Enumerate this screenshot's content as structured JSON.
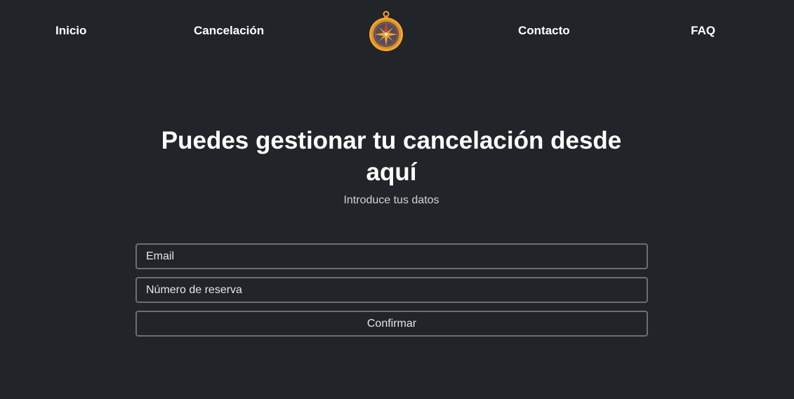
{
  "nav": {
    "links": [
      {
        "label": "Inicio"
      },
      {
        "label": "Cancelación"
      },
      {
        "label": "Contacto"
      },
      {
        "label": "FAQ"
      }
    ],
    "logo_icon": "compass-icon"
  },
  "hero": {
    "title": "Puedes gestionar tu cancelación desde aquí",
    "subtitle": "Introduce tus datos"
  },
  "form": {
    "email": {
      "placeholder": "Email",
      "value": ""
    },
    "booking": {
      "placeholder": "Número de reserva",
      "value": ""
    },
    "submit_label": "Confirmar"
  },
  "colors": {
    "background": "#212428",
    "text": "#ffffff",
    "border": "#6b6f75",
    "accent": "#f2a531"
  }
}
